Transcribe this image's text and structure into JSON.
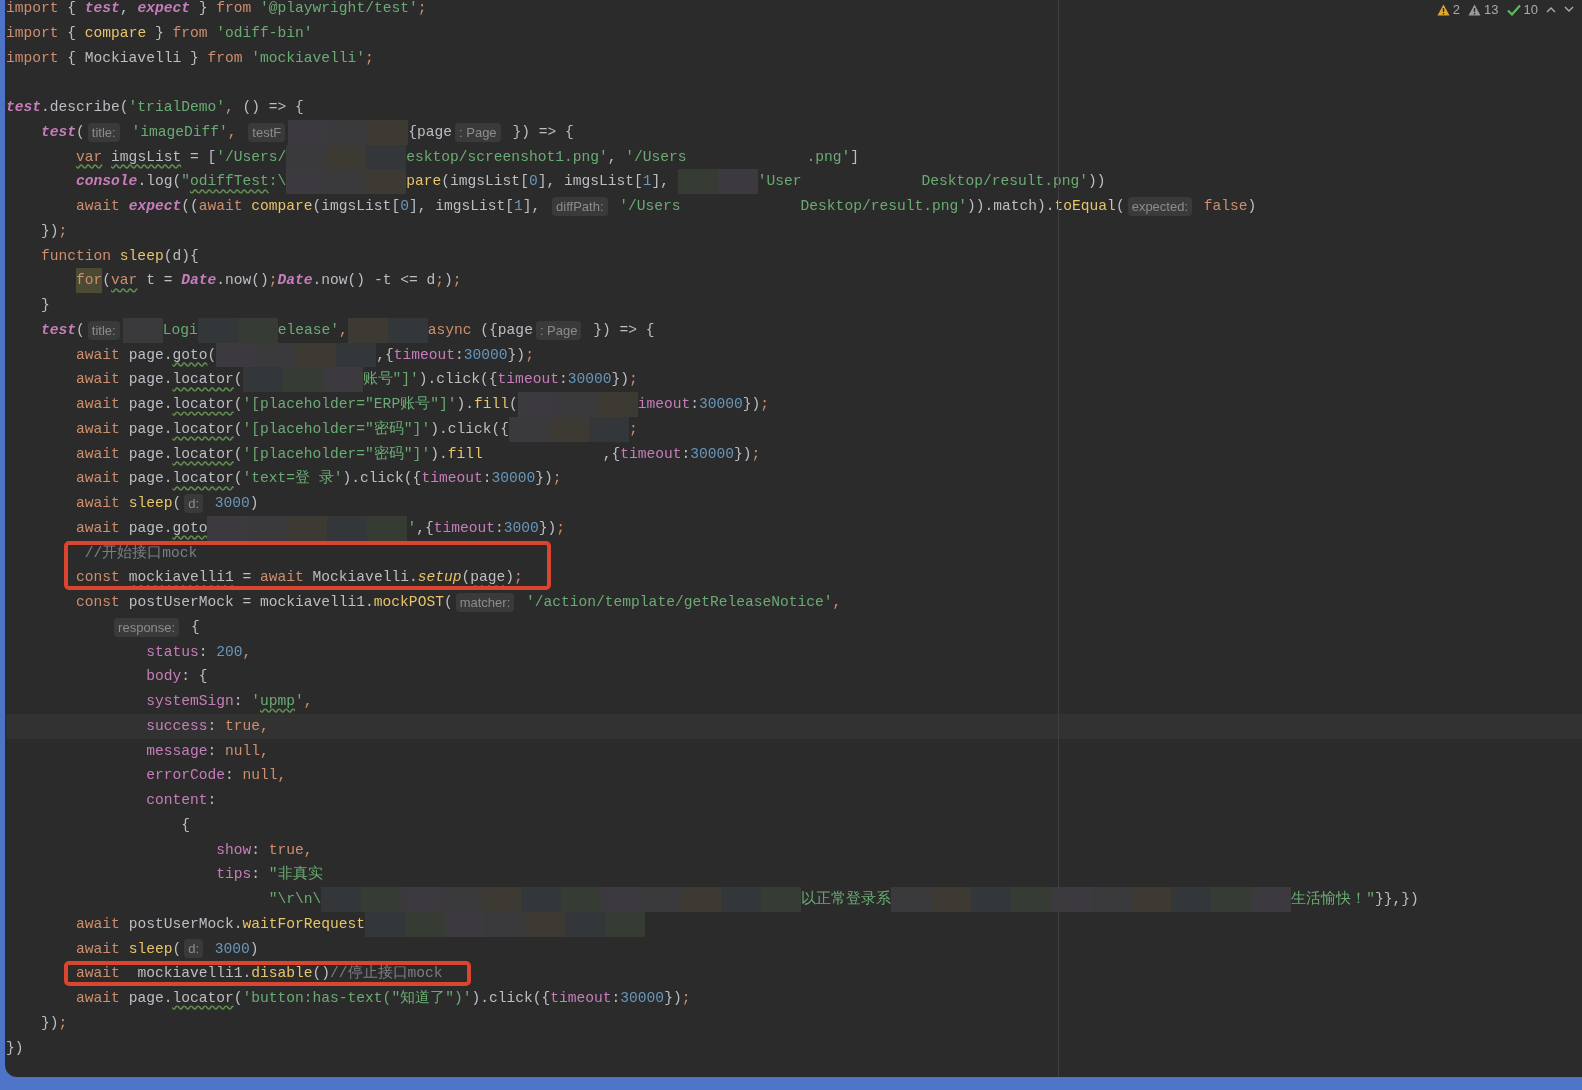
{
  "status": {
    "inspections": [
      {
        "kind": "warning",
        "count": "2"
      },
      {
        "kind": "weak_warning",
        "count": "13"
      },
      {
        "kind": "typo",
        "count": "10"
      }
    ]
  },
  "imports": [
    {
      "tokens": [
        {
          "kind": "kw",
          "t": "import"
        },
        {
          "kind": "id",
          "t": " { "
        },
        {
          "kind": "iv",
          "t": "test"
        },
        {
          "kind": "id",
          "t": ", "
        },
        {
          "kind": "iv",
          "t": "expect"
        },
        {
          "kind": "id",
          "t": " } "
        },
        {
          "kind": "kw",
          "t": "from"
        },
        {
          "kind": "str",
          "t": " '@playwright/test'"
        },
        {
          "kind": "kw",
          "t": ";"
        }
      ]
    },
    {
      "tokens": [
        {
          "kind": "kw",
          "t": "import"
        },
        {
          "kind": "id",
          "t": " { "
        },
        {
          "kind": "fn",
          "t": "compare"
        },
        {
          "kind": "id",
          "t": " } "
        },
        {
          "kind": "kw",
          "t": "from"
        },
        {
          "kind": "str",
          "t": " 'odiff-bin'"
        }
      ]
    },
    {
      "tokens": [
        {
          "kind": "kw",
          "t": "import"
        },
        {
          "kind": "id",
          "t": " { Mockiavelli } "
        },
        {
          "kind": "kw",
          "t": "from"
        },
        {
          "kind": "str",
          "t": " 'mockiavelli'"
        },
        {
          "kind": "kw",
          "t": ";"
        }
      ]
    }
  ],
  "lines": [
    {
      "tokens": [
        {
          "kind": "iv",
          "t": "test"
        },
        {
          "kind": "id",
          "t": ".describe("
        },
        {
          "kind": "str",
          "t": "'trialDemo'"
        },
        {
          "kind": "kw",
          "t": ","
        },
        {
          "kind": "id",
          "t": " () => {"
        }
      ]
    },
    {
      "tokens": [
        {
          "kind": "iv",
          "t": "    test"
        },
        {
          "kind": "id",
          "t": "("
        },
        {
          "kind": "hint",
          "t": "title:"
        },
        {
          "kind": "str",
          "t": " 'imageDiff'"
        },
        {
          "kind": "kw",
          "t": ","
        },
        {
          "kind": "hint",
          "t": " testF"
        },
        {
          "kind": "px"
        },
        {
          "kind": "px"
        },
        {
          "kind": "px"
        },
        {
          "kind": "id",
          "t": "{page"
        },
        {
          "kind": "hint",
          "t": ": Page"
        },
        {
          "kind": "id",
          "t": " }) => {"
        }
      ]
    },
    {
      "tokens": [
        {
          "kind": "kw",
          "t": "        var",
          "wavy": true
        },
        {
          "kind": "id",
          "t": " imgsList",
          "wavy": true
        },
        {
          "kind": "id",
          "t": " = ["
        },
        {
          "kind": "str",
          "t": "'/Users/"
        },
        {
          "kind": "px"
        },
        {
          "kind": "px"
        },
        {
          "kind": "px"
        },
        {
          "kind": "str",
          "t": "esktop/screenshot1.png'"
        },
        {
          "kind": "id",
          "t": ", "
        },
        {
          "kind": "str",
          "t": "'/Users"
        },
        {
          "kind": "gap"
        },
        {
          "kind": "gap"
        },
        {
          "kind": "gap"
        },
        {
          "kind": "str",
          "t": ".png'"
        },
        {
          "kind": "id",
          "t": "]"
        }
      ]
    },
    {
      "tokens": [
        {
          "kind": "iv",
          "t": "        console"
        },
        {
          "kind": "id",
          "t": ".log("
        },
        {
          "kind": "str",
          "t": "\""
        },
        {
          "kind": "str",
          "t": "odiffTest",
          "wavy": true
        },
        {
          "kind": "str",
          "t": ":\\"
        },
        {
          "kind": "px"
        },
        {
          "kind": "px"
        },
        {
          "kind": "px"
        },
        {
          "kind": "fn",
          "t": "pare"
        },
        {
          "kind": "id",
          "t": "(imgsList["
        },
        {
          "kind": "num",
          "t": "0"
        },
        {
          "kind": "id",
          "t": "], imgsList["
        },
        {
          "kind": "num",
          "t": "1"
        },
        {
          "kind": "id",
          "t": "], "
        },
        {
          "kind": "px"
        },
        {
          "kind": "px"
        },
        {
          "kind": "str",
          "t": "'User"
        },
        {
          "kind": "gap"
        },
        {
          "kind": "gap"
        },
        {
          "kind": "gap"
        },
        {
          "kind": "str",
          "t": "Desktop/result.png'"
        },
        {
          "kind": "id",
          "t": "))"
        }
      ]
    },
    {
      "tokens": [
        {
          "kind": "kw",
          "t": "        await "
        },
        {
          "kind": "iv",
          "t": "expect"
        },
        {
          "kind": "id",
          "t": "(("
        },
        {
          "kind": "kw",
          "t": "await "
        },
        {
          "kind": "fn",
          "t": "compare"
        },
        {
          "kind": "id",
          "t": "(imgsList["
        },
        {
          "kind": "num",
          "t": "0"
        },
        {
          "kind": "id",
          "t": "], imgsList["
        },
        {
          "kind": "num",
          "t": "1"
        },
        {
          "kind": "id",
          "t": "], "
        },
        {
          "kind": "hint",
          "t": "diffPath:"
        },
        {
          "kind": "str",
          "t": " '/Users"
        },
        {
          "kind": "gap"
        },
        {
          "kind": "gap"
        },
        {
          "kind": "gap"
        },
        {
          "kind": "str",
          "t": "Desktop/result.png'"
        },
        {
          "kind": "id",
          "t": ")).match)."
        },
        {
          "kind": "fn",
          "t": "toEqual"
        },
        {
          "kind": "id",
          "t": "("
        },
        {
          "kind": "hint",
          "t": "expected:"
        },
        {
          "kind": "kw",
          "t": " false"
        },
        {
          "kind": "id",
          "t": ")"
        }
      ]
    },
    {
      "tokens": [
        {
          "kind": "id",
          "t": "    })"
        },
        {
          "kind": "kw",
          "t": ";"
        }
      ]
    },
    {
      "tokens": [
        {
          "kind": "kw",
          "t": "    function "
        },
        {
          "kind": "fn",
          "t": "sleep"
        },
        {
          "kind": "id",
          "t": "(d){"
        }
      ]
    },
    {
      "tokens": [
        {
          "kind": "kw",
          "t": "        for",
          "highlighted": true
        },
        {
          "kind": "id",
          "t": "("
        },
        {
          "kind": "kw",
          "t": "var",
          "wavy": true
        },
        {
          "kind": "id",
          "t": " t = "
        },
        {
          "kind": "iv",
          "t": "Date"
        },
        {
          "kind": "id",
          "t": ".now()"
        },
        {
          "kind": "kw",
          "t": ";"
        },
        {
          "kind": "iv",
          "t": "Date"
        },
        {
          "kind": "id",
          "t": ".now() -t <= d"
        },
        {
          "kind": "kw",
          "t": ";"
        },
        {
          "kind": "id",
          "t": ")"
        },
        {
          "kind": "kw",
          "t": ";"
        }
      ]
    },
    {
      "tokens": [
        {
          "kind": "id",
          "t": "    }"
        }
      ]
    },
    {
      "tokens": [
        {
          "kind": "iv",
          "t": "    test"
        },
        {
          "kind": "id",
          "t": "("
        },
        {
          "kind": "hint",
          "t": "title:"
        },
        {
          "kind": "px"
        },
        {
          "kind": "str",
          "t": "Logi"
        },
        {
          "kind": "px"
        },
        {
          "kind": "px"
        },
        {
          "kind": "str",
          "t": "elease'"
        },
        {
          "kind": "kw",
          "t": ","
        },
        {
          "kind": "px"
        },
        {
          "kind": "px"
        },
        {
          "kind": "kw",
          "t": "async"
        },
        {
          "kind": "id",
          "t": " ({page"
        },
        {
          "kind": "hint",
          "t": ": Page"
        },
        {
          "kind": "id",
          "t": " }) => {"
        }
      ]
    },
    {
      "tokens": [
        {
          "kind": "kw",
          "t": "        await "
        },
        {
          "kind": "id",
          "t": "page."
        },
        {
          "kind": "id",
          "t": "goto",
          "wavy": true
        },
        {
          "kind": "id",
          "t": "("
        },
        {
          "kind": "px"
        },
        {
          "kind": "px"
        },
        {
          "kind": "px"
        },
        {
          "kind": "px"
        },
        {
          "kind": "id",
          "t": ",{"
        },
        {
          "kind": "prop",
          "t": "timeout"
        },
        {
          "kind": "id",
          "t": ":"
        },
        {
          "kind": "num",
          "t": "30000"
        },
        {
          "kind": "id",
          "t": "})"
        },
        {
          "kind": "kw",
          "t": ";"
        }
      ]
    },
    {
      "tokens": [
        {
          "kind": "kw",
          "t": "        await "
        },
        {
          "kind": "id",
          "t": "page."
        },
        {
          "kind": "id",
          "t": "locator",
          "wavy": true
        },
        {
          "kind": "id",
          "t": "("
        },
        {
          "kind": "px"
        },
        {
          "kind": "px"
        },
        {
          "kind": "px"
        },
        {
          "kind": "str",
          "t": "账号\"]'"
        },
        {
          "kind": "id",
          "t": ").click({"
        },
        {
          "kind": "prop",
          "t": "timeout"
        },
        {
          "kind": "id",
          "t": ":"
        },
        {
          "kind": "num",
          "t": "30000"
        },
        {
          "kind": "id",
          "t": "})"
        },
        {
          "kind": "kw",
          "t": ";"
        }
      ]
    },
    {
      "tokens": [
        {
          "kind": "kw",
          "t": "        await "
        },
        {
          "kind": "id",
          "t": "page."
        },
        {
          "kind": "id",
          "t": "locator",
          "wavy": true
        },
        {
          "kind": "id",
          "t": "("
        },
        {
          "kind": "str",
          "t": "'[placeholder=\"ERP账号\"]'"
        },
        {
          "kind": "id",
          "t": ")."
        },
        {
          "kind": "fn",
          "t": "fill"
        },
        {
          "kind": "id",
          "t": "("
        },
        {
          "kind": "px"
        },
        {
          "kind": "px"
        },
        {
          "kind": "px"
        },
        {
          "kind": "prop",
          "t": "imeout"
        },
        {
          "kind": "id",
          "t": ":"
        },
        {
          "kind": "num",
          "t": "30000"
        },
        {
          "kind": "id",
          "t": "})"
        },
        {
          "kind": "kw",
          "t": ";"
        }
      ]
    },
    {
      "tokens": [
        {
          "kind": "kw",
          "t": "        await "
        },
        {
          "kind": "id",
          "t": "page."
        },
        {
          "kind": "id",
          "t": "locator",
          "wavy": true
        },
        {
          "kind": "id",
          "t": "("
        },
        {
          "kind": "str",
          "t": "'[placeholder=\"密码\"]'"
        },
        {
          "kind": "id",
          "t": ").click({"
        },
        {
          "kind": "px"
        },
        {
          "kind": "px"
        },
        {
          "kind": "px"
        },
        {
          "kind": "kw",
          "t": ";"
        }
      ]
    },
    {
      "tokens": [
        {
          "kind": "kw",
          "t": "        await "
        },
        {
          "kind": "id",
          "t": "page."
        },
        {
          "kind": "id",
          "t": "locator",
          "wavy": true
        },
        {
          "kind": "id",
          "t": "("
        },
        {
          "kind": "str",
          "t": "'[placeholder=\"密码\"]'"
        },
        {
          "kind": "id",
          "t": ")."
        },
        {
          "kind": "fn",
          "t": "fill"
        },
        {
          "kind": "gap"
        },
        {
          "kind": "gap"
        },
        {
          "kind": "gap"
        },
        {
          "kind": "id",
          "t": ",{"
        },
        {
          "kind": "prop",
          "t": "timeout"
        },
        {
          "kind": "id",
          "t": ":"
        },
        {
          "kind": "num",
          "t": "30000"
        },
        {
          "kind": "id",
          "t": "})"
        },
        {
          "kind": "kw",
          "t": ";"
        }
      ]
    },
    {
      "tokens": [
        {
          "kind": "kw",
          "t": "        await "
        },
        {
          "kind": "id",
          "t": "page."
        },
        {
          "kind": "id",
          "t": "locator",
          "wavy": true
        },
        {
          "kind": "id",
          "t": "("
        },
        {
          "kind": "str",
          "t": "'text=登 录'"
        },
        {
          "kind": "id",
          "t": ").click({"
        },
        {
          "kind": "prop",
          "t": "timeout"
        },
        {
          "kind": "id",
          "t": ":"
        },
        {
          "kind": "num",
          "t": "30000"
        },
        {
          "kind": "id",
          "t": "})"
        },
        {
          "kind": "kw",
          "t": ";"
        }
      ]
    },
    {
      "tokens": [
        {
          "kind": "kw",
          "t": "        await "
        },
        {
          "kind": "fn",
          "t": "sleep"
        },
        {
          "kind": "id",
          "t": "("
        },
        {
          "kind": "hint",
          "t": "d:"
        },
        {
          "kind": "num",
          "t": " 3000"
        },
        {
          "kind": "id",
          "t": ")"
        }
      ]
    },
    {
      "tokens": [
        {
          "kind": "kw",
          "t": "        await "
        },
        {
          "kind": "id",
          "t": "page."
        },
        {
          "kind": "id",
          "t": "goto",
          "wavy": true
        },
        {
          "kind": "px"
        },
        {
          "kind": "px"
        },
        {
          "kind": "px"
        },
        {
          "kind": "px"
        },
        {
          "kind": "px"
        },
        {
          "kind": "str",
          "t": "'"
        },
        {
          "kind": "id",
          "t": ",{"
        },
        {
          "kind": "prop",
          "t": "timeout"
        },
        {
          "kind": "id",
          "t": ":"
        },
        {
          "kind": "num",
          "t": "3000"
        },
        {
          "kind": "id",
          "t": "})"
        },
        {
          "kind": "kw",
          "t": ";"
        }
      ]
    },
    {
      "boxed": true,
      "tokens": [
        {
          "kind": "cm",
          "t": "         //开始接口mock"
        }
      ]
    },
    {
      "boxed": true,
      "tokens": [
        {
          "kind": "kw",
          "t": "        const "
        },
        {
          "kind": "id",
          "t": "mockiavelli1",
          "wavy": true
        },
        {
          "kind": "id",
          "t": " = "
        },
        {
          "kind": "kw",
          "t": "await "
        },
        {
          "kind": "id",
          "t": "Mockiavelli."
        },
        {
          "kind": "fn",
          "t": "setup",
          "italic": true
        },
        {
          "kind": "id",
          "t": "("
        },
        {
          "kind": "id",
          "t": "page",
          "wavy": true
        },
        {
          "kind": "id",
          "t": ")"
        },
        {
          "kind": "kw",
          "t": ";"
        }
      ]
    },
    {
      "tokens": [
        {
          "kind": "kw",
          "t": "        const "
        },
        {
          "kind": "id",
          "t": "postUserMock = mockiavelli1."
        },
        {
          "kind": "fn",
          "t": "mockPOST"
        },
        {
          "kind": "id",
          "t": "("
        },
        {
          "kind": "hint",
          "t": "matcher:"
        },
        {
          "kind": "str",
          "t": " '/action/template/getReleaseNotice'"
        },
        {
          "kind": "kw",
          "t": ","
        }
      ]
    },
    {
      "tokens": [
        {
          "kind": "hint",
          "t": "            response:"
        },
        {
          "kind": "id",
          "t": " {"
        }
      ]
    },
    {
      "tokens": [
        {
          "kind": "prop",
          "t": "                status"
        },
        {
          "kind": "id",
          "t": ": "
        },
        {
          "kind": "num",
          "t": "200"
        },
        {
          "kind": "kw",
          "t": ","
        }
      ]
    },
    {
      "tokens": [
        {
          "kind": "prop",
          "t": "                body"
        },
        {
          "kind": "id",
          "t": ": {"
        }
      ]
    },
    {
      "tokens": [
        {
          "kind": "prop",
          "t": "                systemSign"
        },
        {
          "kind": "id",
          "t": ": "
        },
        {
          "kind": "str",
          "t": "'"
        },
        {
          "kind": "str",
          "t": "upmp",
          "wavy": true
        },
        {
          "kind": "str",
          "t": "'"
        },
        {
          "kind": "kw",
          "t": ","
        }
      ]
    },
    {
      "current": true,
      "tokens": [
        {
          "kind": "prop",
          "t": "                success"
        },
        {
          "kind": "id",
          "t": ": "
        },
        {
          "kind": "kw",
          "t": "true,"
        }
      ]
    },
    {
      "tokens": [
        {
          "kind": "prop",
          "t": "                message"
        },
        {
          "kind": "id",
          "t": ": "
        },
        {
          "kind": "kw",
          "t": "null,"
        }
      ]
    },
    {
      "tokens": [
        {
          "kind": "prop",
          "t": "                errorCode"
        },
        {
          "kind": "id",
          "t": ": "
        },
        {
          "kind": "kw",
          "t": "null,"
        }
      ]
    },
    {
      "tokens": [
        {
          "kind": "prop",
          "t": "                content"
        },
        {
          "kind": "id",
          "t": ":"
        }
      ]
    },
    {
      "tokens": [
        {
          "kind": "id",
          "t": "                    {"
        }
      ]
    },
    {
      "tokens": [
        {
          "kind": "prop",
          "t": "                        show"
        },
        {
          "kind": "id",
          "t": ": "
        },
        {
          "kind": "kw",
          "t": "true,"
        }
      ]
    },
    {
      "tokens": [
        {
          "kind": "prop",
          "t": "                        tips"
        },
        {
          "kind": "id",
          "t": ": "
        },
        {
          "kind": "str",
          "t": "\"非真实"
        }
      ]
    },
    {
      "tokens": [
        {
          "kind": "str",
          "t": "                              \"\\r\\n\\"
        },
        {
          "kind": "px"
        },
        {
          "kind": "px"
        },
        {
          "kind": "px"
        },
        {
          "kind": "px"
        },
        {
          "kind": "px"
        },
        {
          "kind": "px"
        },
        {
          "kind": "px"
        },
        {
          "kind": "px"
        },
        {
          "kind": "px"
        },
        {
          "kind": "px"
        },
        {
          "kind": "px"
        },
        {
          "kind": "px"
        },
        {
          "kind": "str",
          "t": "以正常登录系"
        },
        {
          "kind": "px"
        },
        {
          "kind": "px"
        },
        {
          "kind": "px"
        },
        {
          "kind": "px"
        },
        {
          "kind": "px"
        },
        {
          "kind": "px"
        },
        {
          "kind": "px"
        },
        {
          "kind": "px"
        },
        {
          "kind": "px"
        },
        {
          "kind": "px"
        },
        {
          "kind": "str",
          "t": "生活愉快！\""
        },
        {
          "kind": "id",
          "t": "}},})"
        }
      ]
    },
    {
      "tokens": [
        {
          "kind": "kw",
          "t": "        await "
        },
        {
          "kind": "id",
          "t": "postUserMock."
        },
        {
          "kind": "fn",
          "t": "waitForRequest"
        },
        {
          "kind": "px"
        },
        {
          "kind": "px"
        },
        {
          "kind": "px"
        },
        {
          "kind": "px"
        },
        {
          "kind": "px"
        },
        {
          "kind": "px"
        },
        {
          "kind": "px"
        }
      ]
    },
    {
      "tokens": [
        {
          "kind": "kw",
          "t": "        await "
        },
        {
          "kind": "fn",
          "t": "sleep"
        },
        {
          "kind": "id",
          "t": "("
        },
        {
          "kind": "hint",
          "t": "d:"
        },
        {
          "kind": "num",
          "t": " 3000"
        },
        {
          "kind": "id",
          "t": ")"
        }
      ]
    },
    {
      "boxed": true,
      "tokens": [
        {
          "kind": "kw",
          "t": "        await "
        },
        {
          "kind": "id",
          "t": " mockiavelli1."
        },
        {
          "kind": "fn",
          "t": "disable"
        },
        {
          "kind": "id",
          "t": "()"
        },
        {
          "kind": "cm",
          "t": "//停止接口mock"
        }
      ]
    },
    {
      "tokens": [
        {
          "kind": "kw",
          "t": "        await "
        },
        {
          "kind": "id",
          "t": "page."
        },
        {
          "kind": "id",
          "t": "locator",
          "wavy": true
        },
        {
          "kind": "id",
          "t": "("
        },
        {
          "kind": "str",
          "t": "'button:has-text(\"知道了\")'"
        },
        {
          "kind": "id",
          "t": ").click({"
        },
        {
          "kind": "prop",
          "t": "timeout"
        },
        {
          "kind": "id",
          "t": ":"
        },
        {
          "kind": "num",
          "t": "30000"
        },
        {
          "kind": "id",
          "t": "})"
        },
        {
          "kind": "kw",
          "t": ";"
        }
      ]
    },
    {
      "tokens": [
        {
          "kind": "id",
          "t": "    })"
        },
        {
          "kind": "kw",
          "t": ";"
        }
      ]
    },
    {
      "tokens": [
        {
          "kind": "id",
          "t": "})"
        }
      ]
    }
  ]
}
